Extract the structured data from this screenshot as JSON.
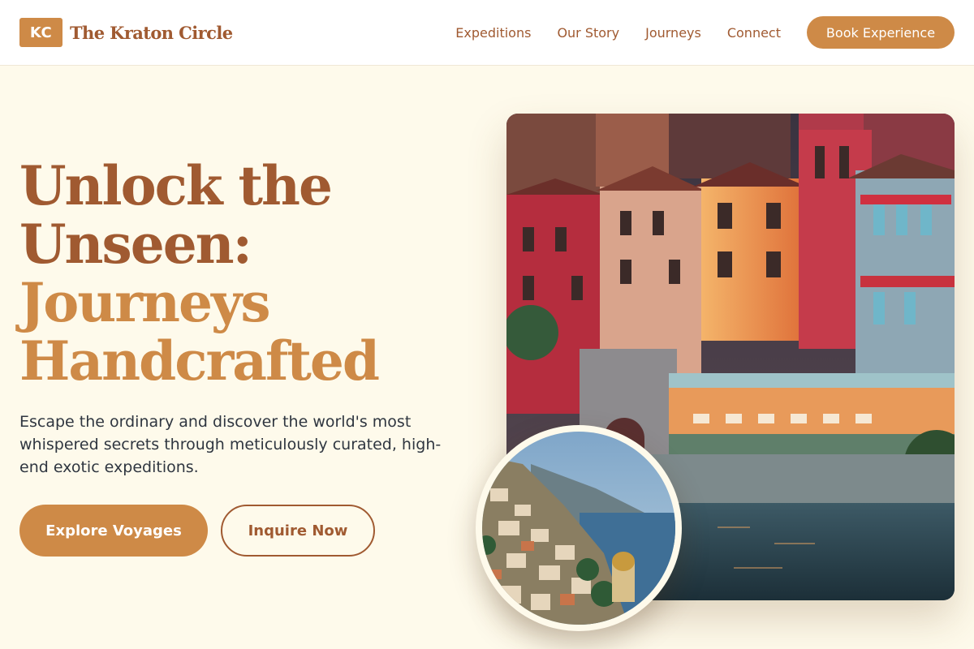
{
  "brand": {
    "badge": "KC",
    "name": "The Kraton Circle"
  },
  "nav": {
    "items": [
      "Expeditions",
      "Our Story",
      "Journeys",
      "Connect"
    ],
    "cta": "Book Experience"
  },
  "hero": {
    "title_line1": "Unlock the",
    "title_line2": "Unseen:",
    "title_line3": "Journeys",
    "title_line4": "Handcrafted",
    "description": "Escape the ordinary and discover the world's most whispered secrets through meticulously curated, high-end exotic expeditions.",
    "primary_button": "Explore Voyages",
    "secondary_button": "Inquire Now"
  },
  "colors": {
    "background": "#FEFAEB",
    "brand_dark": "#A05A31",
    "brand_accent": "#CE8A47",
    "body_text": "#2F3640"
  },
  "images": {
    "main": "lakeside-village-at-dusk-photo",
    "inset": "cliffside-coastal-town-photo"
  }
}
